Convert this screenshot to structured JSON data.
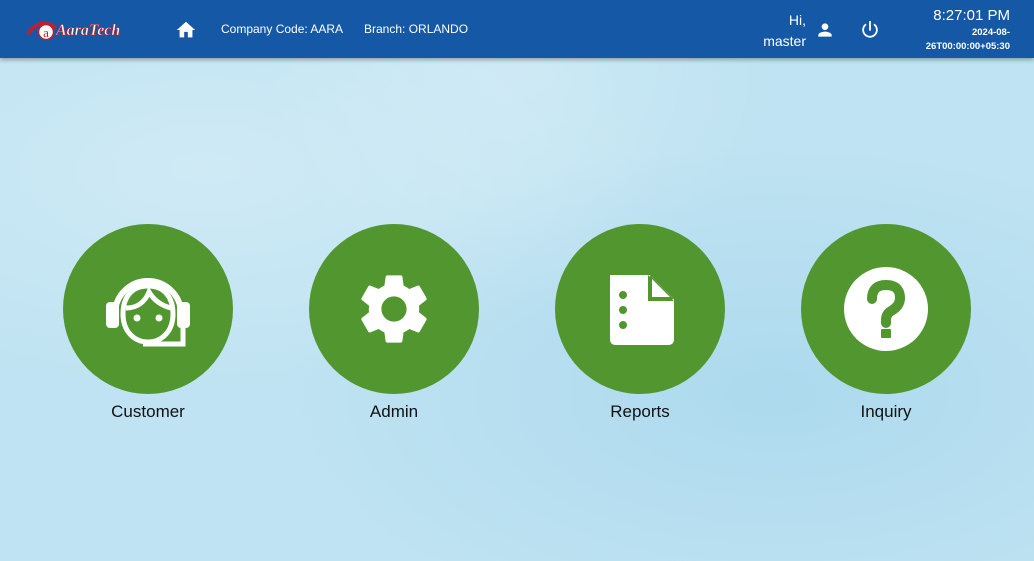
{
  "header": {
    "logo_text": "AaraTech",
    "company_code": "Company Code: AARA",
    "branch": "Branch: ORLANDO",
    "greeting": "Hi,",
    "username": "master",
    "time": "8:27:01 PM",
    "date_line1": "2024-08-",
    "date_line2": "26T00:00:00+05:30",
    "icons": [
      "home-icon",
      "user-icon",
      "power-icon"
    ]
  },
  "tiles": [
    {
      "label": "Customer",
      "icon": "headset-agent-icon"
    },
    {
      "label": "Admin",
      "icon": "gear-icon"
    },
    {
      "label": "Reports",
      "icon": "document-list-icon"
    },
    {
      "label": "Inquiry",
      "icon": "question-mark-icon"
    }
  ],
  "colors": {
    "header": "#1558a6",
    "tile": "#52962f",
    "background": "#bfe3f2",
    "logo_red": "#c0202a"
  }
}
